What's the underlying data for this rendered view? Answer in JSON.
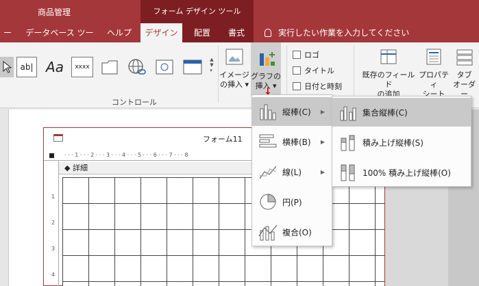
{
  "title_bar": {
    "app_title": "商品管理",
    "context_tools": "フォーム デザイン ツール"
  },
  "tabs": [
    {
      "label": "ータ"
    },
    {
      "label": "データベース ツール"
    },
    {
      "label": "ヘルプ"
    },
    {
      "label": "デザイン"
    },
    {
      "label": "配置"
    },
    {
      "label": "書式"
    }
  ],
  "tell_me": "実行したい作業を入力してください",
  "ribbon": {
    "controls": {
      "textbox": "ab|",
      "label": "Aa",
      "button": "xxxx",
      "group_label": "コントロール"
    },
    "image_insert": {
      "line1": "イメージ",
      "line2": "の挿入 ▾"
    },
    "chart_insert": {
      "line1": "グラフの",
      "line2": "挿入 ▾"
    },
    "header_footer": {
      "logo": "ロゴ",
      "title": "タイトル",
      "datetime": "日付と時刻"
    },
    "tools": {
      "add_fields": {
        "line1": "既存のフィールド",
        "line2": "の追加"
      },
      "property_sheet": {
        "line1": "プロパティ",
        "line2": "シート"
      },
      "tab_order": {
        "line1": "タブ",
        "line2": "オーダー"
      }
    }
  },
  "form": {
    "title": "フォーム11",
    "section": "詳細",
    "ruler_h": "·  ·  ·  1  ·  ·  ·  2  ·  ·  ·  3  ·  ·  ·  4  ·  ·  ·  5  ·  ·  ·  6  ·  ·  ·  7  ·  ·  ·  8",
    "ruler_v": [
      "1",
      "2",
      "3",
      "4"
    ]
  },
  "chart_menu": [
    {
      "label": "縦棒(C)",
      "icon": "column-chart-icon"
    },
    {
      "label": "横棒(B)",
      "icon": "bar-chart-icon"
    },
    {
      "label": "線(L)",
      "icon": "line-chart-icon"
    },
    {
      "label": "円(P)",
      "icon": "pie-chart-icon"
    },
    {
      "label": "複合(O)",
      "icon": "combo-chart-icon"
    }
  ],
  "column_submenu": [
    {
      "label": "集合縦棒(C)",
      "icon": "clustered-column-icon"
    },
    {
      "label": "積み上げ縦棒(S)",
      "icon": "stacked-column-icon"
    },
    {
      "label": "100% 積み上げ縦棒(O)",
      "icon": "100-stacked-column-icon"
    }
  ],
  "colors": {
    "accent": "#a4373a",
    "context_tab": "#7d1f22",
    "highlight": "#c9c9c9"
  }
}
